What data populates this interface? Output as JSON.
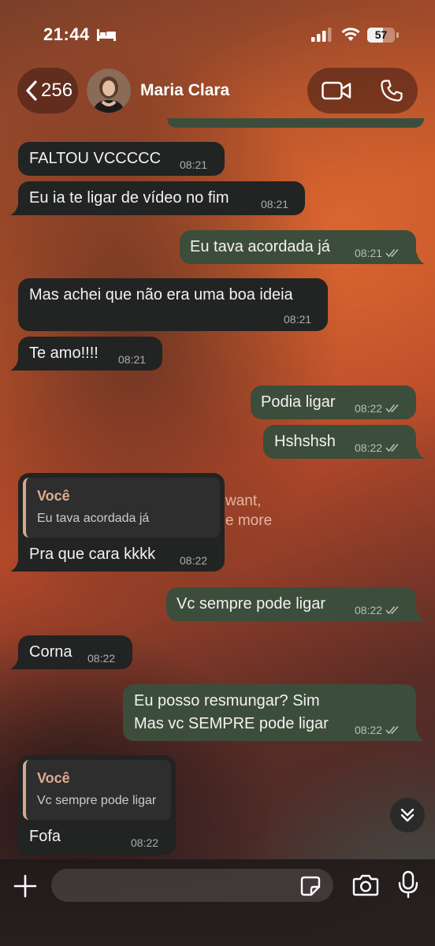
{
  "status_bar": {
    "time": "21:44",
    "battery_level": "57",
    "battery_fraction": 0.57
  },
  "header": {
    "back_count": "256",
    "contact_name": "Maria Clara"
  },
  "wallpaper_text": "want,\ne more",
  "messages": [
    {
      "dir": "in",
      "text": "FALTOU VCCCCC",
      "time": "08:21"
    },
    {
      "dir": "in",
      "text": "Eu ia te ligar de vídeo no fim",
      "time": "08:21"
    },
    {
      "dir": "out",
      "text": "Eu tava acordada já",
      "time": "08:21"
    },
    {
      "dir": "in",
      "text": "Mas achei que não era uma boa ideia",
      "time": "08:21"
    },
    {
      "dir": "in",
      "text": "Te amo!!!!",
      "time": "08:21"
    },
    {
      "dir": "out",
      "text": "Podia ligar",
      "time": "08:22"
    },
    {
      "dir": "out",
      "text": "Hshshsh",
      "time": "08:22"
    },
    {
      "dir": "in",
      "reply_author": "Você",
      "reply_text": "Eu tava acordada já",
      "text": "Pra que cara kkkk",
      "time": "08:22"
    },
    {
      "dir": "out",
      "text": "Vc sempre pode ligar",
      "time": "08:22"
    },
    {
      "dir": "in",
      "text": "Corna",
      "time": "08:22"
    },
    {
      "dir": "out",
      "text_line1": "Eu posso resmungar? Sim",
      "text_line2": "Mas vc SEMPRE pode ligar",
      "time": "08:22"
    },
    {
      "dir": "in",
      "reply_author": "Você",
      "reply_text": "Vc sempre pode ligar",
      "text": "Fofa",
      "time": "08:22"
    }
  ],
  "input": {
    "placeholder": ""
  },
  "icons": {
    "back": "chevron-left-icon",
    "video": "video-camera-icon",
    "phone": "phone-icon",
    "attach": "plus-icon",
    "sticker": "sticker-icon",
    "camera": "camera-icon",
    "mic": "microphone-icon",
    "scroll": "double-chevron-down-icon"
  },
  "colors": {
    "incoming_bubble": "#222323",
    "outgoing_bubble": "#3d4d3b",
    "reply_accent": "#e0ab8e"
  }
}
